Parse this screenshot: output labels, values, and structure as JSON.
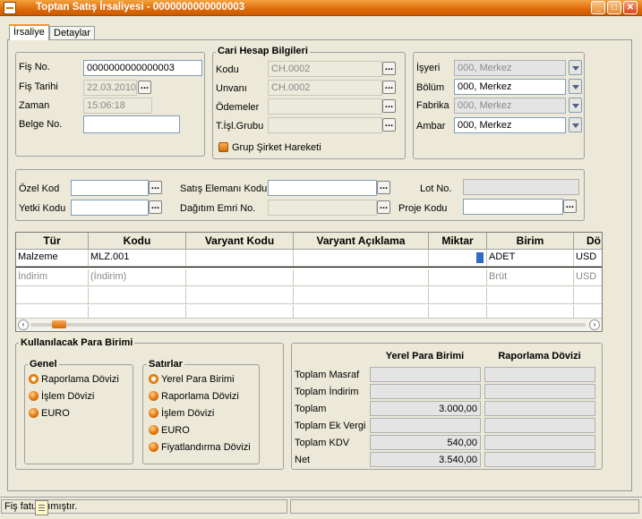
{
  "window": {
    "title": "Toptan Satış İrsaliyesi - 0000000000000003"
  },
  "tabs": [
    "İrsaliye",
    "Detaylar"
  ],
  "header": {
    "fis_no": {
      "label": "Fiş No.",
      "value": "0000000000000003"
    },
    "fis_tarihi": {
      "label": "Fiş Tarihi",
      "value": "22.03.2010"
    },
    "zaman": {
      "label": "Zaman",
      "value": "15:06:18"
    },
    "belge_no": {
      "label": "Belge No.",
      "value": ""
    }
  },
  "cari": {
    "title": "Cari Hesap Bilgileri",
    "kodu": {
      "label": "Kodu",
      "value": "CH.0002"
    },
    "unvani": {
      "label": "Unvanı",
      "value": "CH.0002"
    },
    "odemeler": {
      "label": "Ödemeler",
      "value": ""
    },
    "tisl": {
      "label": "T.İşl.Grubu",
      "value": ""
    },
    "grup": "Grup Şirket Hareketi"
  },
  "org": {
    "isyeri": {
      "label": "İşyeri",
      "value": "000, Merkez"
    },
    "bolum": {
      "label": "Bölüm",
      "value": "000, Merkez"
    },
    "fabrika": {
      "label": "Fabrika",
      "value": "000, Merkez"
    },
    "ambar": {
      "label": "Ambar",
      "value": "000, Merkez"
    }
  },
  "codes": {
    "ozel_kod": "Özel Kod",
    "yetki_kodu": "Yetki Kodu",
    "satis_elemani": "Satış Elemanı Kodu",
    "dagitim": "Dağıtım Emri No.",
    "lot_no": "Lot No.",
    "proje_kodu": "Proje Kodu"
  },
  "grid": {
    "headers": [
      "Tür",
      "Kodu",
      "Varyant Kodu",
      "Varyant Açıklama",
      "Miktar",
      "Birim",
      "Dö"
    ],
    "rows": [
      [
        "Malzeme",
        "MLZ.001",
        "",
        "",
        "",
        "ADET",
        "USD"
      ],
      [
        "İndirim",
        "(İndirim)",
        "",
        "",
        "",
        "Brüt",
        "USD"
      ]
    ]
  },
  "currency": {
    "title": "Kullanılacak Para Birimi",
    "genel": {
      "title": "Genel",
      "options": [
        "Raporlama Dövizi",
        "İşlem Dövizi",
        "EURO"
      ]
    },
    "satirlar": {
      "title": "Satırlar",
      "options": [
        "Yerel Para Birimi",
        "Raporlama Dövizi",
        "İşlem Dövizi",
        "EURO",
        "Fiyatlandırma Dövizi"
      ]
    }
  },
  "totals": {
    "col1": "Yerel Para Birimi",
    "col2": "Raporlama Dövizi",
    "rows": [
      {
        "label": "Toplam Masraf",
        "v1": "",
        "v2": ""
      },
      {
        "label": "Toplam İndirim",
        "v1": "",
        "v2": ""
      },
      {
        "label": "Toplam",
        "v1": "3.000,00",
        "v2": ""
      },
      {
        "label": "Toplam Ek Vergi",
        "v1": "",
        "v2": ""
      },
      {
        "label": "Toplam KDV",
        "v1": "540,00",
        "v2": ""
      },
      {
        "label": "Net",
        "v1": "3.540,00",
        "v2": ""
      }
    ]
  },
  "status": {
    "text": "Fiş fatu... ımıştır."
  },
  "colors": {
    "accent": "#f29b1e",
    "titlebar": "#e06a0a"
  }
}
